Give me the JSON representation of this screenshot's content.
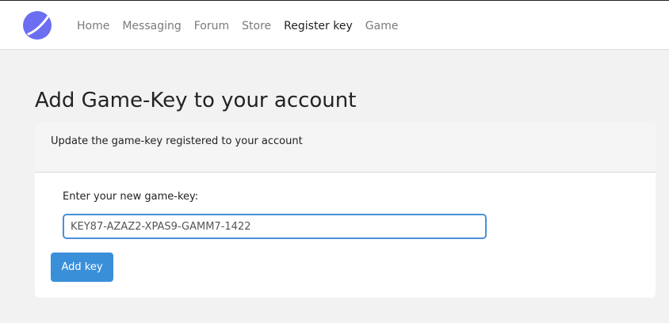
{
  "brand": {
    "icon": "planet-logo-icon",
    "accent_color": "#6b6ef0"
  },
  "nav": {
    "items": [
      {
        "label": "Home",
        "active": false
      },
      {
        "label": "Messaging",
        "active": false
      },
      {
        "label": "Forum",
        "active": false
      },
      {
        "label": "Store",
        "active": false
      },
      {
        "label": "Register key",
        "active": true
      },
      {
        "label": "Game",
        "active": false
      }
    ]
  },
  "page": {
    "title": "Add Game-Key to your account"
  },
  "card": {
    "header": "Update the game-key registered to your account",
    "field_label": "Enter your new game-key:",
    "key_value": "KEY87-AZAZ2-XPAS9-GAMM7-1422",
    "button_label": "Add key",
    "button_color": "#3a8fd9"
  }
}
